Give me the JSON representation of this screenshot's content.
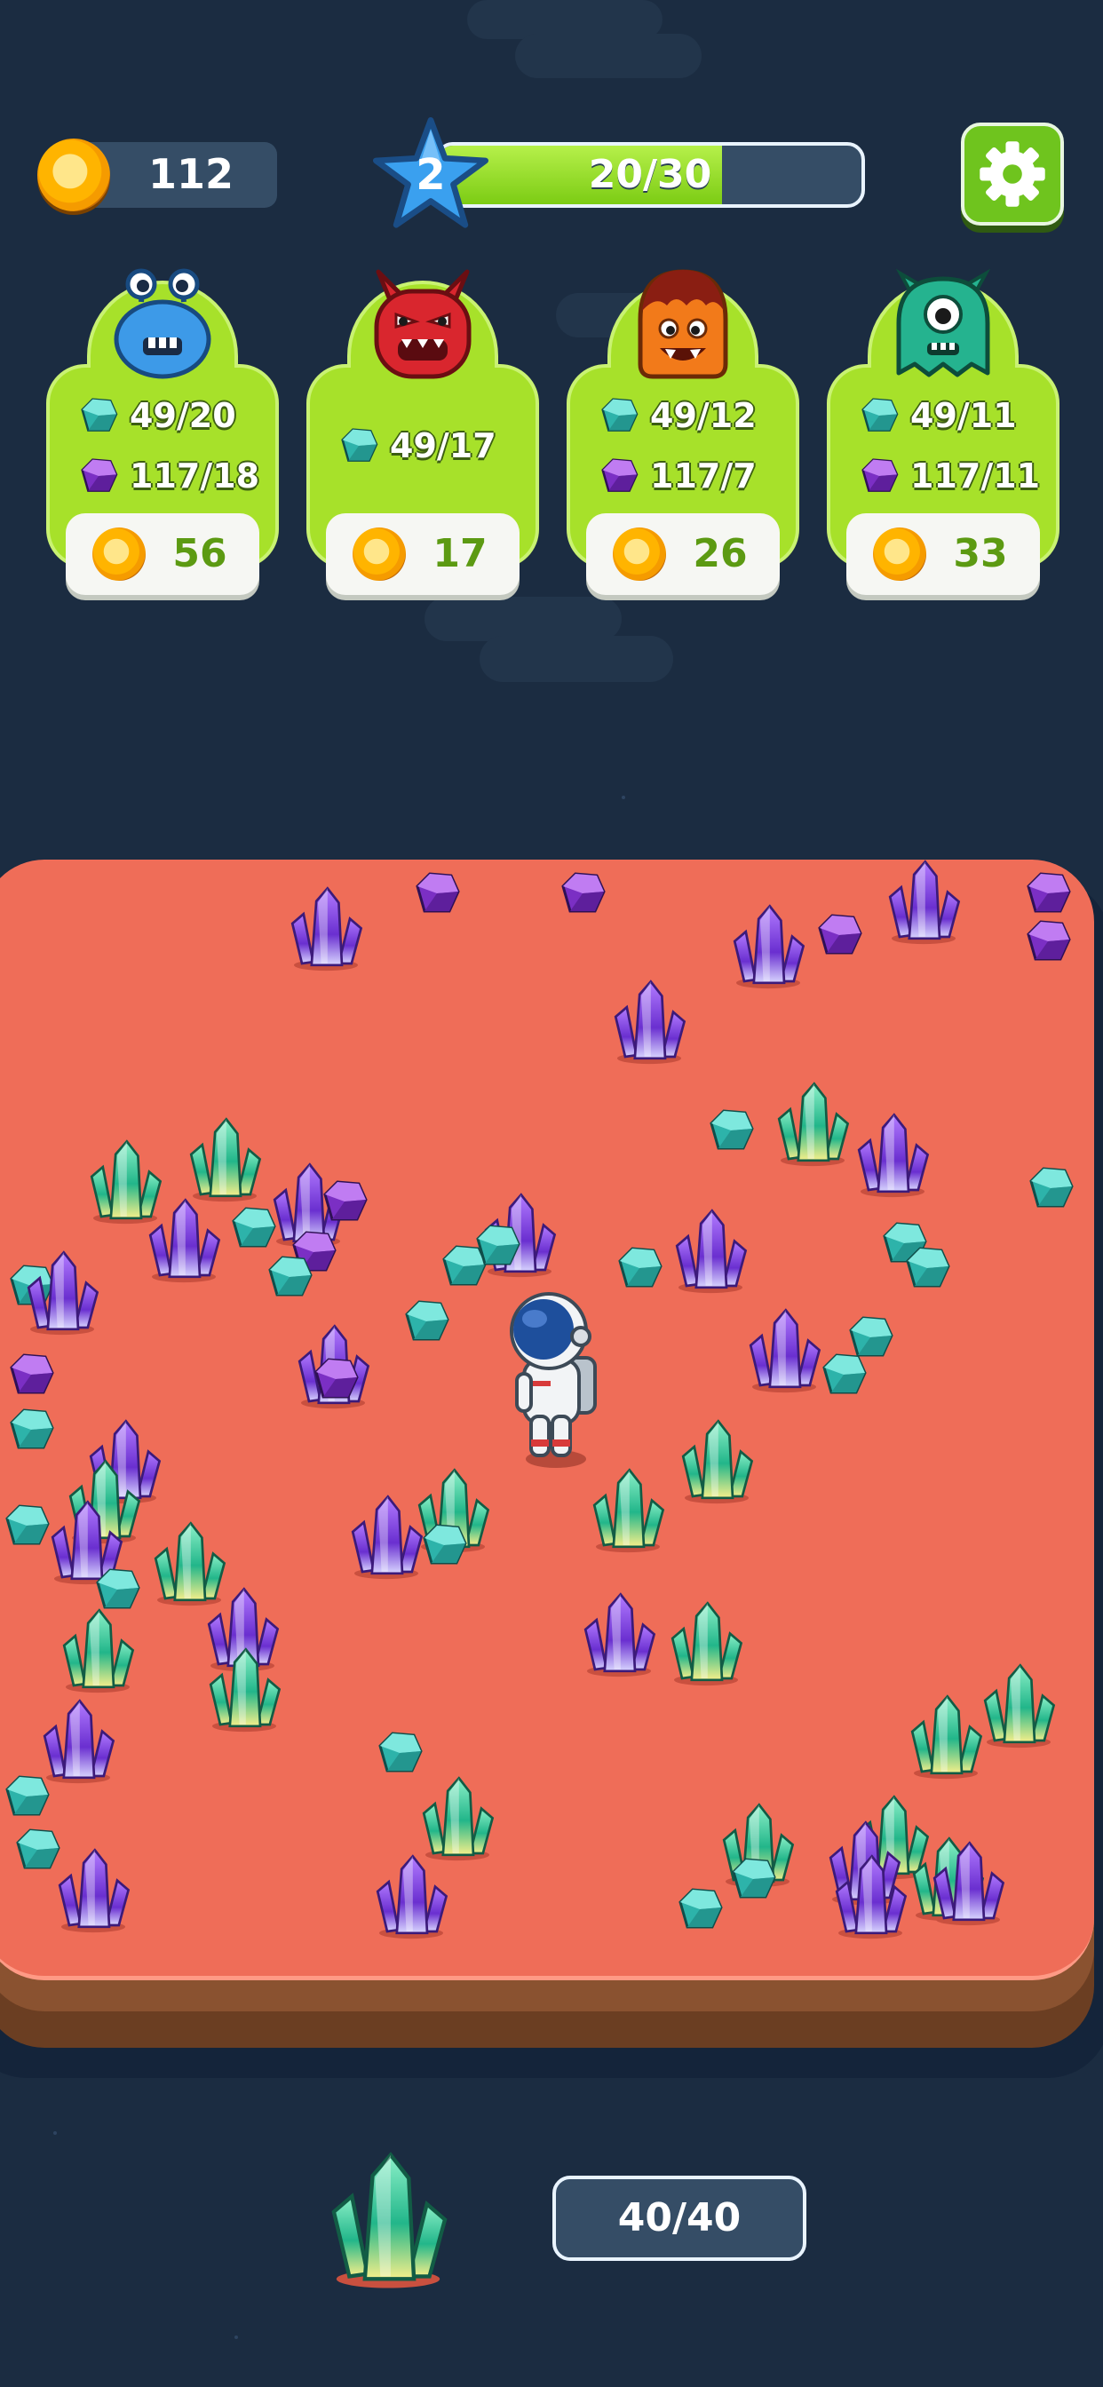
{
  "hud": {
    "coins": "112",
    "level": "2",
    "xp_text": "20/30",
    "xp_progress": 0.67,
    "settings_icon": "gear-icon"
  },
  "orders": [
    {
      "monster": "blue-blob-monster",
      "color": "#3d9ae8",
      "requirements": [
        {
          "gem": "teal-gem",
          "value": "49/20"
        },
        {
          "gem": "purple-gem",
          "value": "117/18"
        }
      ],
      "reward": "56"
    },
    {
      "monster": "red-horned-monster",
      "color": "#d9262e",
      "requirements": [
        {
          "gem": "teal-gem",
          "value": "49/17"
        }
      ],
      "reward": "17"
    },
    {
      "monster": "orange-lava-monster",
      "color": "#f27a1a",
      "requirements": [
        {
          "gem": "teal-gem",
          "value": "49/12"
        },
        {
          "gem": "purple-gem",
          "value": "117/7"
        }
      ],
      "reward": "26"
    },
    {
      "monster": "green-cyclops-monster",
      "color": "#25b38f",
      "requirements": [
        {
          "gem": "teal-gem",
          "value": "49/11"
        },
        {
          "gem": "purple-gem",
          "value": "117/11"
        }
      ],
      "reward": "33"
    }
  ],
  "inventory": {
    "item": "green-crystal-icon",
    "capacity_text": "40/40"
  },
  "colors": {
    "background": "#1b2c41",
    "field": "#ef6d58",
    "card": "#a7e12a",
    "xp_fill": "#8ed61f",
    "teal_gem": "#3ec9c0",
    "purple_gem": "#8a3fd6",
    "green_crystal": "#35d69a"
  }
}
